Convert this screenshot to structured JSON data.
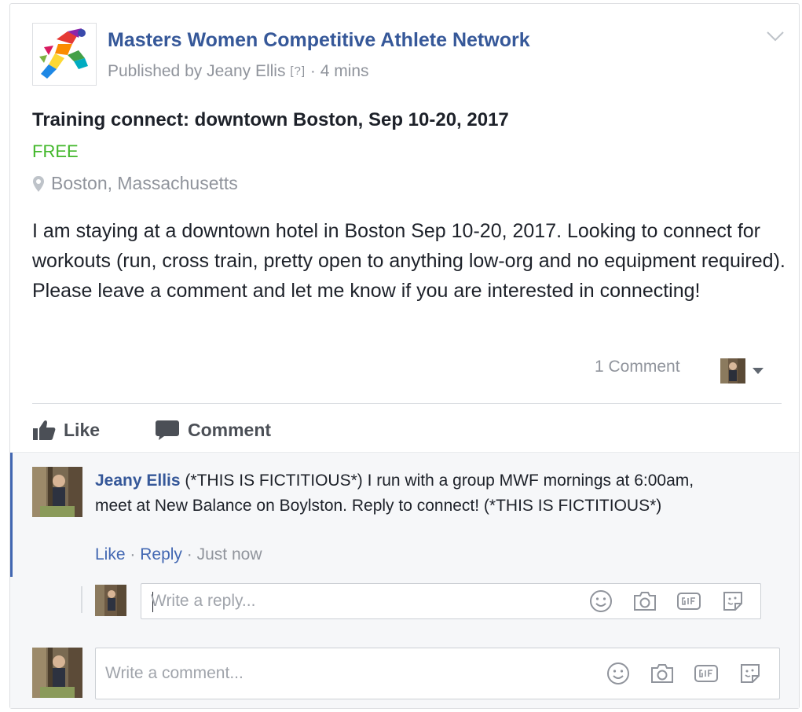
{
  "post": {
    "group_name": "Masters Women Competitive Athlete Network",
    "published_prefix": "Published by",
    "author": "Jeany Ellis",
    "help_mark": "[?]",
    "separator": "·",
    "time_ago": "4 mins",
    "logo_icon": "running-athlete-logo"
  },
  "event": {
    "title": "Training connect: downtown Boston, Sep 10-20, 2017",
    "price": "FREE",
    "location": "Boston, Massachusetts",
    "body": "I am staying at a downtown hotel in Boston Sep 10-20, 2017. Looking to connect for workouts (run, cross train, pretty open to anything low-org and no equipment required). Please leave a comment and let me know if you are interested in connecting!"
  },
  "stats": {
    "comment_count": "1 Comment"
  },
  "actions": {
    "like": "Like",
    "comment": "Comment"
  },
  "comment": {
    "author": "Jeany Ellis",
    "text": "(*THIS IS FICTITIOUS*) I run with a group MWF mornings at 6:00am, meet at New Balance on Boylston. Reply to connect! (*THIS IS FICTITIOUS*)",
    "like": "Like",
    "reply": "Reply",
    "separator": "·",
    "time": "Just now"
  },
  "reply_box": {
    "placeholder": "Write a reply..."
  },
  "comment_box": {
    "placeholder": "Write a comment..."
  },
  "colors": {
    "link": "#365899",
    "price": "#42b72a",
    "muted": "#90949c",
    "focus_bar": "#4267b2"
  }
}
